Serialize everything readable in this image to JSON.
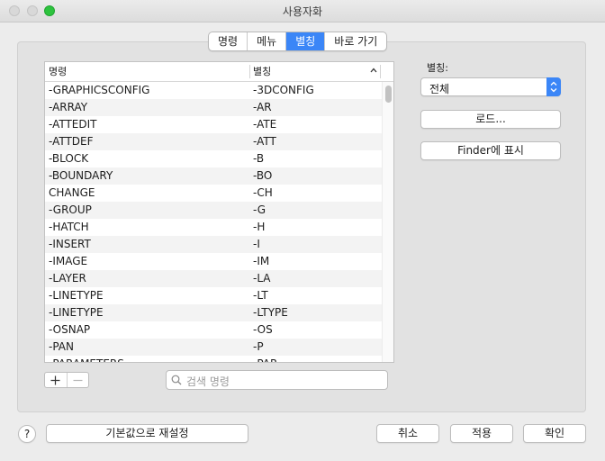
{
  "window": {
    "title": "사용자화"
  },
  "tabs": [
    {
      "label": "명령",
      "active": false
    },
    {
      "label": "메뉴",
      "active": false
    },
    {
      "label": "별칭",
      "active": true
    },
    {
      "label": "바로 가기",
      "active": false
    }
  ],
  "table": {
    "headers": {
      "command": "명령",
      "alias": "별칭"
    },
    "sort": "ascending",
    "rows": [
      {
        "command": "-GRAPHICSCONFIG",
        "alias": "-3DCONFIG"
      },
      {
        "command": "-ARRAY",
        "alias": "-AR"
      },
      {
        "command": "-ATTEDIT",
        "alias": "-ATE"
      },
      {
        "command": "-ATTDEF",
        "alias": "-ATT"
      },
      {
        "command": "-BLOCK",
        "alias": "-B"
      },
      {
        "command": "-BOUNDARY",
        "alias": "-BO"
      },
      {
        "command": "CHANGE",
        "alias": "-CH"
      },
      {
        "command": "-GROUP",
        "alias": "-G"
      },
      {
        "command": "-HATCH",
        "alias": "-H"
      },
      {
        "command": "-INSERT",
        "alias": "-I"
      },
      {
        "command": "-IMAGE",
        "alias": "-IM"
      },
      {
        "command": "-LAYER",
        "alias": "-LA"
      },
      {
        "command": "-LINETYPE",
        "alias": "-LT"
      },
      {
        "command": "-LINETYPE",
        "alias": "-LTYPE"
      },
      {
        "command": "-OSNAP",
        "alias": "-OS"
      },
      {
        "command": "-PAN",
        "alias": "-P"
      },
      {
        "command": "-PARAMETERS",
        "alias": "-PAR"
      }
    ]
  },
  "search": {
    "placeholder": "검색 명령"
  },
  "alias_filter": {
    "label": "별칭:",
    "value": "전체"
  },
  "buttons": {
    "load": "로드...",
    "show_in_finder": "Finder에 표시",
    "help": "?",
    "reset_defaults": "기본값으로 재설정",
    "cancel": "취소",
    "apply": "적용",
    "ok": "확인"
  },
  "colors": {
    "accent": "#3b86f7",
    "zoom_button": "#2dc33e"
  }
}
